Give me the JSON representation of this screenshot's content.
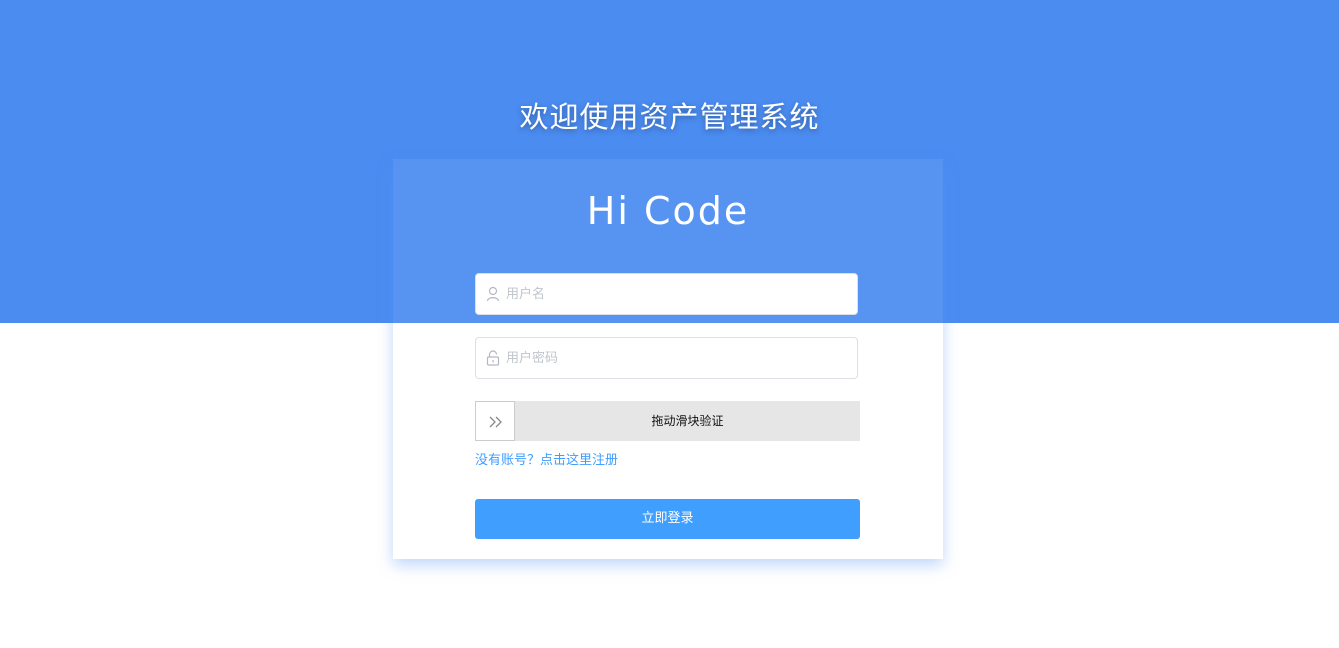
{
  "header": {
    "title": "欢迎使用资产管理系统"
  },
  "card": {
    "brand": "Hi Code"
  },
  "form": {
    "username": {
      "placeholder": "用户名",
      "value": "",
      "icon": "user-icon"
    },
    "password": {
      "placeholder": "用户密码",
      "value": "",
      "icon": "lock-icon"
    },
    "slider": {
      "label": "拖动滑块验证",
      "icon": "double-chevron-right-icon"
    },
    "register_link": "没有账号？点击这里注册",
    "submit_label": "立即登录"
  },
  "colors": {
    "banner": "#4b8cf1",
    "primary": "#409eff",
    "slider_track": "#e6e6e6"
  }
}
